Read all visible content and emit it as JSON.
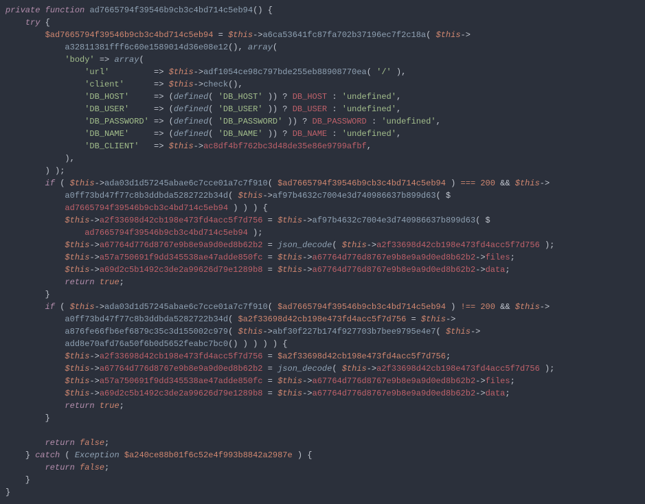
{
  "tokens": {
    "kw_private": "private",
    "kw_function": "function",
    "kw_try": "try",
    "kw_if": "if",
    "kw_return": "return",
    "kw_catch": "catch",
    "kw_array": "array",
    "this": "$this",
    "fn_decl": "ad7665794f39546b9cb3c4bd714c5eb94",
    "var_resp": "$ad7665794f39546b9cb3c4bd714c5eb94",
    "fn_a6ca": "a6ca53641fc87fa702b37196ec7f2c18a",
    "fn_a328": "a32811381fff6c60e1589014d36e08e12",
    "key_body": "'body'",
    "key_url": "'url'",
    "key_client": "'client'",
    "key_dbhost": "'DB_HOST'",
    "key_dbuser": "'DB_USER'",
    "key_dbpw": "'DB_PASSWORD'",
    "key_dbname": "'DB_NAME'",
    "key_dbclient": "'DB_CLIENT'",
    "arrow": "=>",
    "fn_adf1": "adf1054ce98c797bde255eb88908770ea",
    "str_slash": "'/'",
    "fn_check": "check",
    "fn_defined": "defined",
    "str_dbhost": "'DB_HOST'",
    "str_dbuser": "'DB_USER'",
    "str_dbpw": "'DB_PASSWORD'",
    "str_dbname": "'DB_NAME'",
    "c_dbhost": "DB_HOST",
    "c_dbuser": "DB_USER",
    "c_dbpw": "DB_PASSWORD",
    "c_dbname": "DB_NAME",
    "str_undef": "'undefined'",
    "prop_ac8": "ac8df4bf762bc3d48de35e86e9799afbf",
    "fn_ada0": "ada03d1d57245abae6c7cce01a7c7f910",
    "n200": "200",
    "op_and": "&&",
    "op_teq": "===",
    "op_tne": "!==",
    "fn_a0ff": "a0ff73bd47f77c8b3ddbda5282722b34d",
    "fn_af97": "af97b4632c7004e3d740986637b899d63",
    "ref_resp": "ad7665794f39546b9cb3c4bd714c5eb94",
    "prop_a2f3": "a2f33698d42cb198e473fd4acc5f7d756",
    "prop_a677": "a67764d776d8767e9b8e9a9d0ed8b62b2",
    "fn_jsondec": "json_decode",
    "prop_a57a": "a57a750691f9dd345538ae47adde850fc",
    "prop_files": "files",
    "prop_a69d": "a69d2c5b1492c3de2a99626d79e1289b8",
    "prop_data": "data",
    "var_a2f3": "$a2f33698d42cb198e473fd4acc5f7d756",
    "fn_a876": "a876fe66fb6ef6879c35c3d155002c979",
    "fn_abf3": "abf30f227b174f927703b7bee9795e4e7",
    "fn_add8": "add8e70afd76a50f6b0d5652feabc7bc0",
    "bool_true": "true",
    "bool_false": "false",
    "cls_ex": "Exception",
    "var_ex": "$a240ce88b01f6c52e4f993b8842a2987e"
  }
}
